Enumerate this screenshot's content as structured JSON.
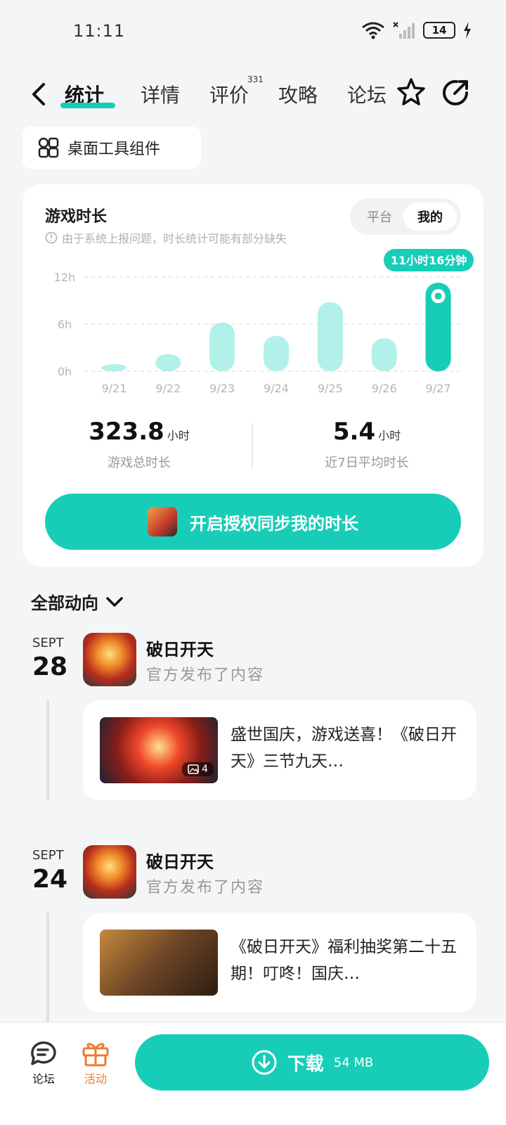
{
  "status": {
    "time": "11:11",
    "battery": "14"
  },
  "nav": {
    "tabs": [
      {
        "label": "统计"
      },
      {
        "label": "详情"
      },
      {
        "label": "评价",
        "badge": "331"
      },
      {
        "label": "攻略"
      },
      {
        "label": "论坛"
      }
    ]
  },
  "widget": {
    "label": "桌面工具组件"
  },
  "stats": {
    "title": "游戏时长",
    "note": "由于系统上报问题，时长统计可能有部分缺失",
    "toggle": [
      "平台",
      "我的"
    ],
    "total_value": "323.8",
    "total_unit": "小时",
    "total_label": "游戏总时长",
    "avg_value": "5.4",
    "avg_unit": "小时",
    "avg_label": "近7日平均时长",
    "sync_label": "开启授权同步我的时长"
  },
  "chart_data": {
    "type": "bar",
    "categories": [
      "9/21",
      "9/22",
      "9/23",
      "9/24",
      "9/25",
      "9/26",
      "9/27"
    ],
    "values": [
      0.8,
      2.2,
      6.2,
      4.5,
      8.8,
      4.2,
      11.27
    ],
    "yticks": [
      "12h",
      "6h",
      "0h"
    ],
    "ylim": [
      0,
      12
    ],
    "highlight_index": 6,
    "highlight_label": "11小时16分钟",
    "colors": {
      "normal": "#b2f1ea",
      "highlight": "#17cdb8"
    }
  },
  "feed": {
    "filter_label": "全部动向",
    "items": [
      {
        "month": "SEPT",
        "day": "28",
        "name": "破日开天",
        "sub": "官方发布了内容",
        "text": "盛世国庆，游戏送喜！《破日开天》三节九天…",
        "img_count": "4"
      },
      {
        "month": "SEPT",
        "day": "24",
        "name": "破日开天",
        "sub": "官方发布了内容",
        "text": "《破日开天》福利抽奖第二十五期！叮咚！国庆…"
      }
    ]
  },
  "bottom": {
    "forum_label": "论坛",
    "activity_label": "活动",
    "download_label": "下载",
    "download_size": "54 MB"
  }
}
